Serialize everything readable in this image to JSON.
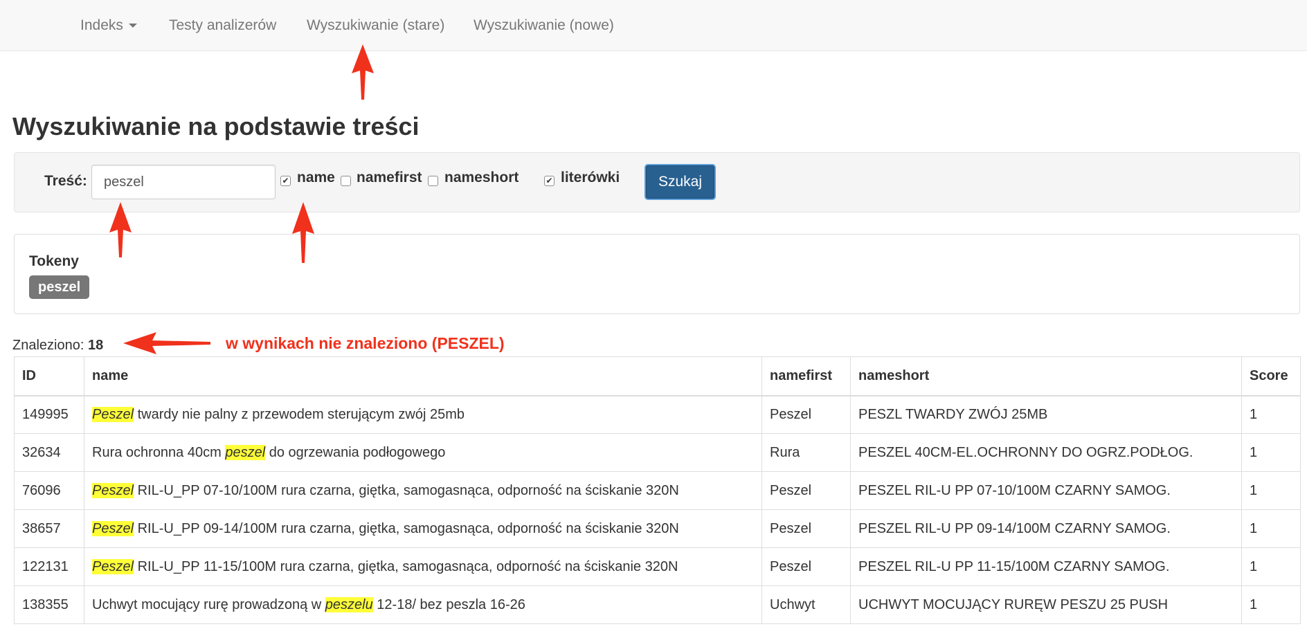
{
  "navbar": {
    "items": [
      {
        "label": "Indeks",
        "has_caret": true
      },
      {
        "label": "Testy analizerów"
      },
      {
        "label": "Wyszukiwanie (stare)"
      },
      {
        "label": "Wyszukiwanie (nowe)"
      }
    ]
  },
  "page_title": "Wyszukiwanie na podstawie treści",
  "form": {
    "label": "Treść:",
    "query_value": "peszel",
    "checkboxes": [
      {
        "label": "name",
        "checked": true
      },
      {
        "label": "namefirst",
        "checked": false
      },
      {
        "label": "nameshort",
        "checked": false
      },
      {
        "label": "literówki",
        "checked": true
      }
    ],
    "submit_label": "Szukaj"
  },
  "tokens": {
    "title": "Tokeny",
    "items": [
      "peszel"
    ]
  },
  "results": {
    "found_label": "Znaleziono:",
    "found_count": "18",
    "annotation": "w wynikach nie znaleziono (PESZEL)",
    "columns": [
      "ID",
      "name",
      "namefirst",
      "nameshort",
      "Score"
    ],
    "rows": [
      {
        "id": "149995",
        "name_before": "",
        "name_hl": "Peszel",
        "name_after": " twardy nie palny z przewodem sterującym zwój 25mb",
        "namefirst": "Peszel",
        "nameshort": "PESZL TWARDY ZWÓJ 25MB",
        "score": "1"
      },
      {
        "id": "32634",
        "name_before": "Rura ochronna 40cm ",
        "name_hl": "peszel",
        "name_after": " do ogrzewania podłogowego",
        "namefirst": "Rura",
        "nameshort": "PESZEL 40CM-EL.OCHRONNY DO OGRZ.PODŁOG.",
        "score": "1"
      },
      {
        "id": "76096",
        "name_before": "",
        "name_hl": "Peszel",
        "name_after": " RIL-U_PP 07-10/100M rura czarna, giętka, samogasnąca, odporność na ściskanie 320N",
        "namefirst": "Peszel",
        "nameshort": "PESZEL RIL-U PP 07-10/100M CZARNY SAMOG.",
        "score": "1"
      },
      {
        "id": "38657",
        "name_before": "",
        "name_hl": "Peszel",
        "name_after": " RIL-U_PP 09-14/100M rura czarna, giętka, samogasnąca, odporność na ściskanie 320N",
        "namefirst": "Peszel",
        "nameshort": "PESZEL RIL-U PP 09-14/100M CZARNY SAMOG.",
        "score": "1"
      },
      {
        "id": "122131",
        "name_before": "",
        "name_hl": "Peszel",
        "name_after": " RIL-U_PP 11-15/100M rura czarna, giętka, samogasnąca, odporność na ściskanie 320N",
        "namefirst": "Peszel",
        "nameshort": "PESZEL RIL-U PP 11-15/100M CZARNY SAMOG.",
        "score": "1"
      },
      {
        "id": "138355",
        "name_before": "Uchwyt mocujący rurę prowadzoną w ",
        "name_hl": "peszelu",
        "name_after": " 12-18/ bez peszla 16-26",
        "namefirst": "Uchwyt",
        "nameshort": "UCHWYT MOCUJĄCY RURĘW PESZU 25 PUSH",
        "score": "1"
      }
    ]
  },
  "colors": {
    "navbar_bg": "#f8f8f8",
    "primary_button": "#286090",
    "badge": "#777777",
    "highlight": "#ffff38",
    "annotation_red": "#f0311c"
  }
}
